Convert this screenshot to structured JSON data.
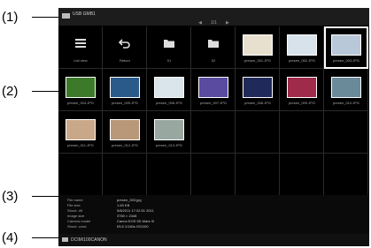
{
  "callouts": [
    "(1)",
    "(2)",
    "(3)",
    "(4)"
  ],
  "topbar": {
    "title": "USB GMB1",
    "page": "1/1",
    "icon": "usb-icon"
  },
  "items": [
    {
      "label": "List view",
      "kind": "list"
    },
    {
      "label": "Return",
      "kind": "return"
    },
    {
      "label": "01",
      "kind": "folder"
    },
    {
      "label": "02",
      "kind": "folder"
    },
    {
      "label": "presen_001.JPG",
      "kind": "photo",
      "color": "#e8e0cf"
    },
    {
      "label": "presen_002.JPG",
      "kind": "photo",
      "color": "#d8e2ea"
    },
    {
      "label": "presen_003.JPG",
      "kind": "photo",
      "color": "#b8c8d8",
      "selected": true
    },
    {
      "label": "presen_004.JPG",
      "kind": "photo",
      "color": "#3c7a2a"
    },
    {
      "label": "presen_005.JPG",
      "kind": "photo",
      "color": "#2a5a8a"
    },
    {
      "label": "presen_006.JPG",
      "kind": "photo",
      "color": "#d9e5ea"
    },
    {
      "label": "presen_007.JPG",
      "kind": "photo",
      "color": "#5a4aa0"
    },
    {
      "label": "presen_008.JPG",
      "kind": "photo",
      "color": "#1f2a5a"
    },
    {
      "label": "presen_009.JPG",
      "kind": "photo",
      "color": "#a02a4a"
    },
    {
      "label": "presen_010.JPG",
      "kind": "photo",
      "color": "#6a8a9a"
    },
    {
      "label": "presen_011.JPG",
      "kind": "photo",
      "color": "#c8a888"
    },
    {
      "label": "presen_012.JPG",
      "kind": "photo",
      "color": "#b89878"
    },
    {
      "label": "presen_013.JPG",
      "kind": "photo",
      "color": "#98a8a0"
    }
  ],
  "info": [
    {
      "key": "File name",
      "value": "presen_003.jpg"
    },
    {
      "key": "File size",
      "value": "1.63 KB"
    },
    {
      "key": "Shoot. d/t",
      "value": "5/8/2011 17:22:51 2011"
    },
    {
      "key": "Image size",
      "value": "3760 × 2448"
    },
    {
      "key": "Camera model",
      "value": "Canon EOS 5D Mark III"
    },
    {
      "key": "Shoot. cond.",
      "value": "f/5.6 1/160s ISO100"
    }
  ],
  "bottombar": {
    "path": "DCIM\\100CANON",
    "icon": "folder-icon"
  }
}
